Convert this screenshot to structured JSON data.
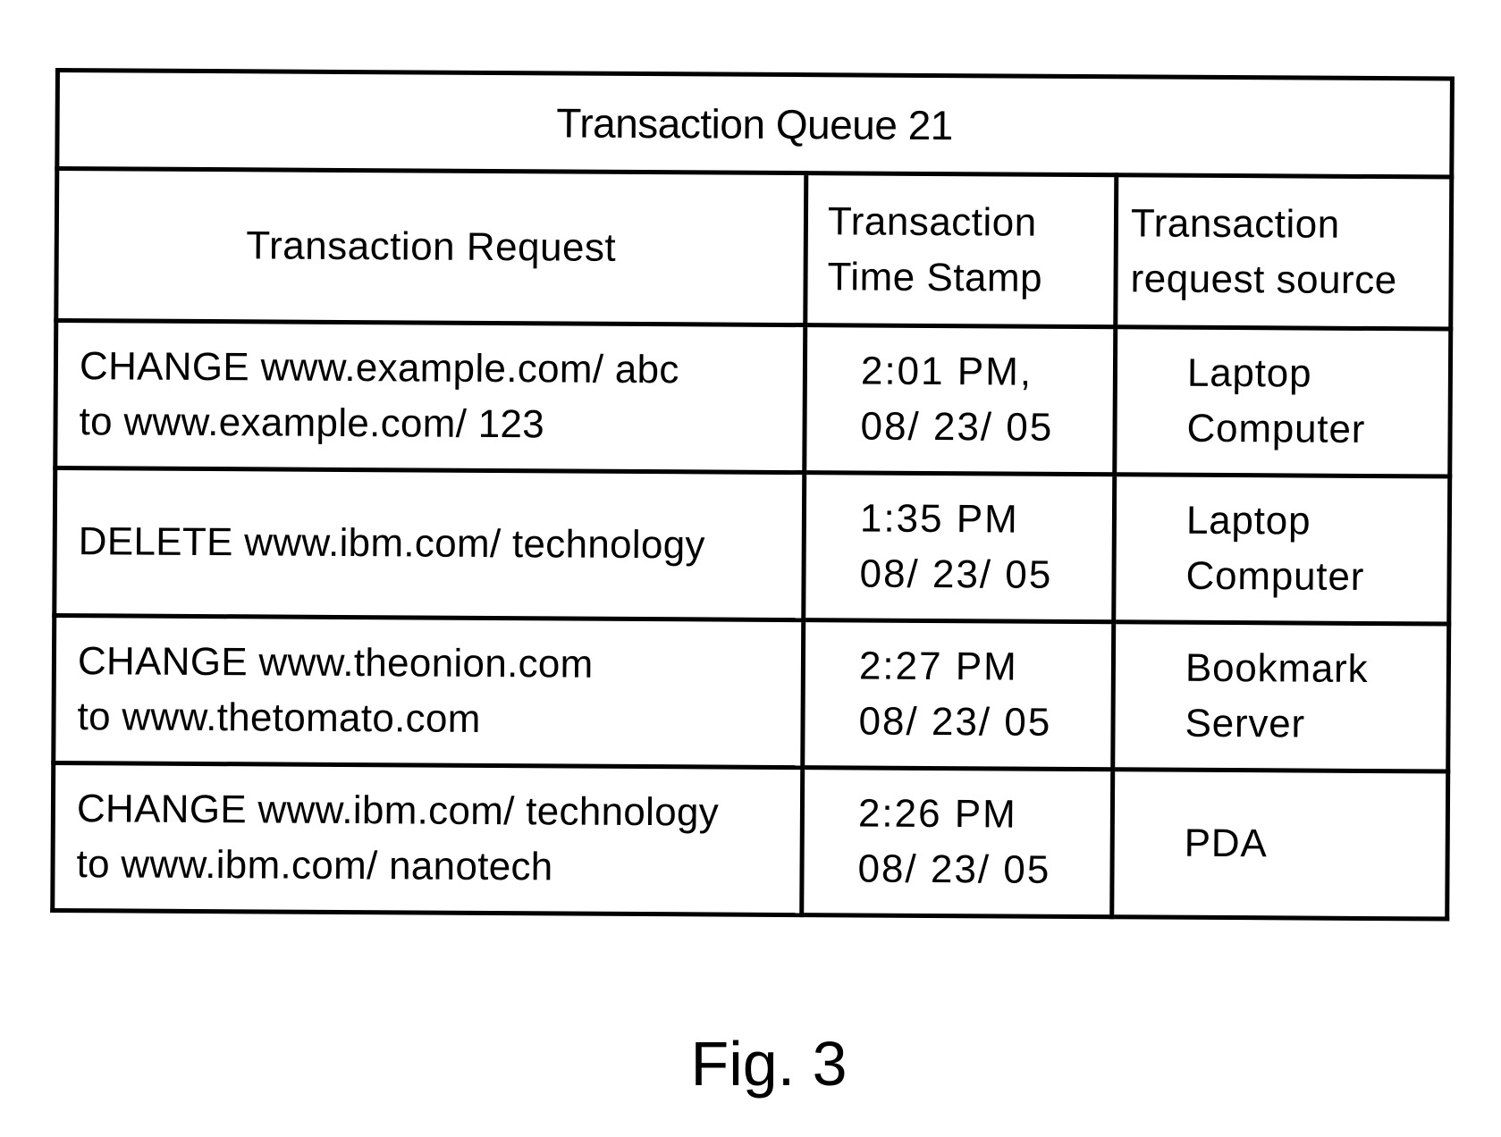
{
  "table": {
    "title": "Transaction Queue  21",
    "headers": [
      {
        "lines": [
          "Transaction Request"
        ]
      },
      {
        "lines": [
          "Transaction",
          "Time Stamp"
        ]
      },
      {
        "lines": [
          "Transaction",
          "request  source"
        ]
      }
    ],
    "rows": [
      {
        "request": [
          "CHANGE www.example.com/ abc",
          "to www.example.com/ 123"
        ],
        "timestamp": [
          "2:01 PM,",
          "08/ 23/ 05"
        ],
        "source": [
          "Laptop",
          "Computer"
        ]
      },
      {
        "request": [
          "DELETE www.ibm.com/ technology"
        ],
        "timestamp": [
          "1:35 PM",
          "08/ 23/ 05"
        ],
        "source": [
          "Laptop",
          "Computer"
        ]
      },
      {
        "request": [
          "CHANGE www.theonion.com",
          "to www.thetomato.com"
        ],
        "timestamp": [
          "2:27 PM",
          "08/ 23/ 05"
        ],
        "source": [
          "Bookmark",
          "Server"
        ]
      },
      {
        "request": [
          "CHANGE www.ibm.com/ technology",
          "to www.ibm.com/ nanotech"
        ],
        "timestamp": [
          "2:26 PM",
          "08/ 23/ 05"
        ],
        "source": [
          "PDA"
        ]
      }
    ]
  },
  "caption": "Fig. 3"
}
